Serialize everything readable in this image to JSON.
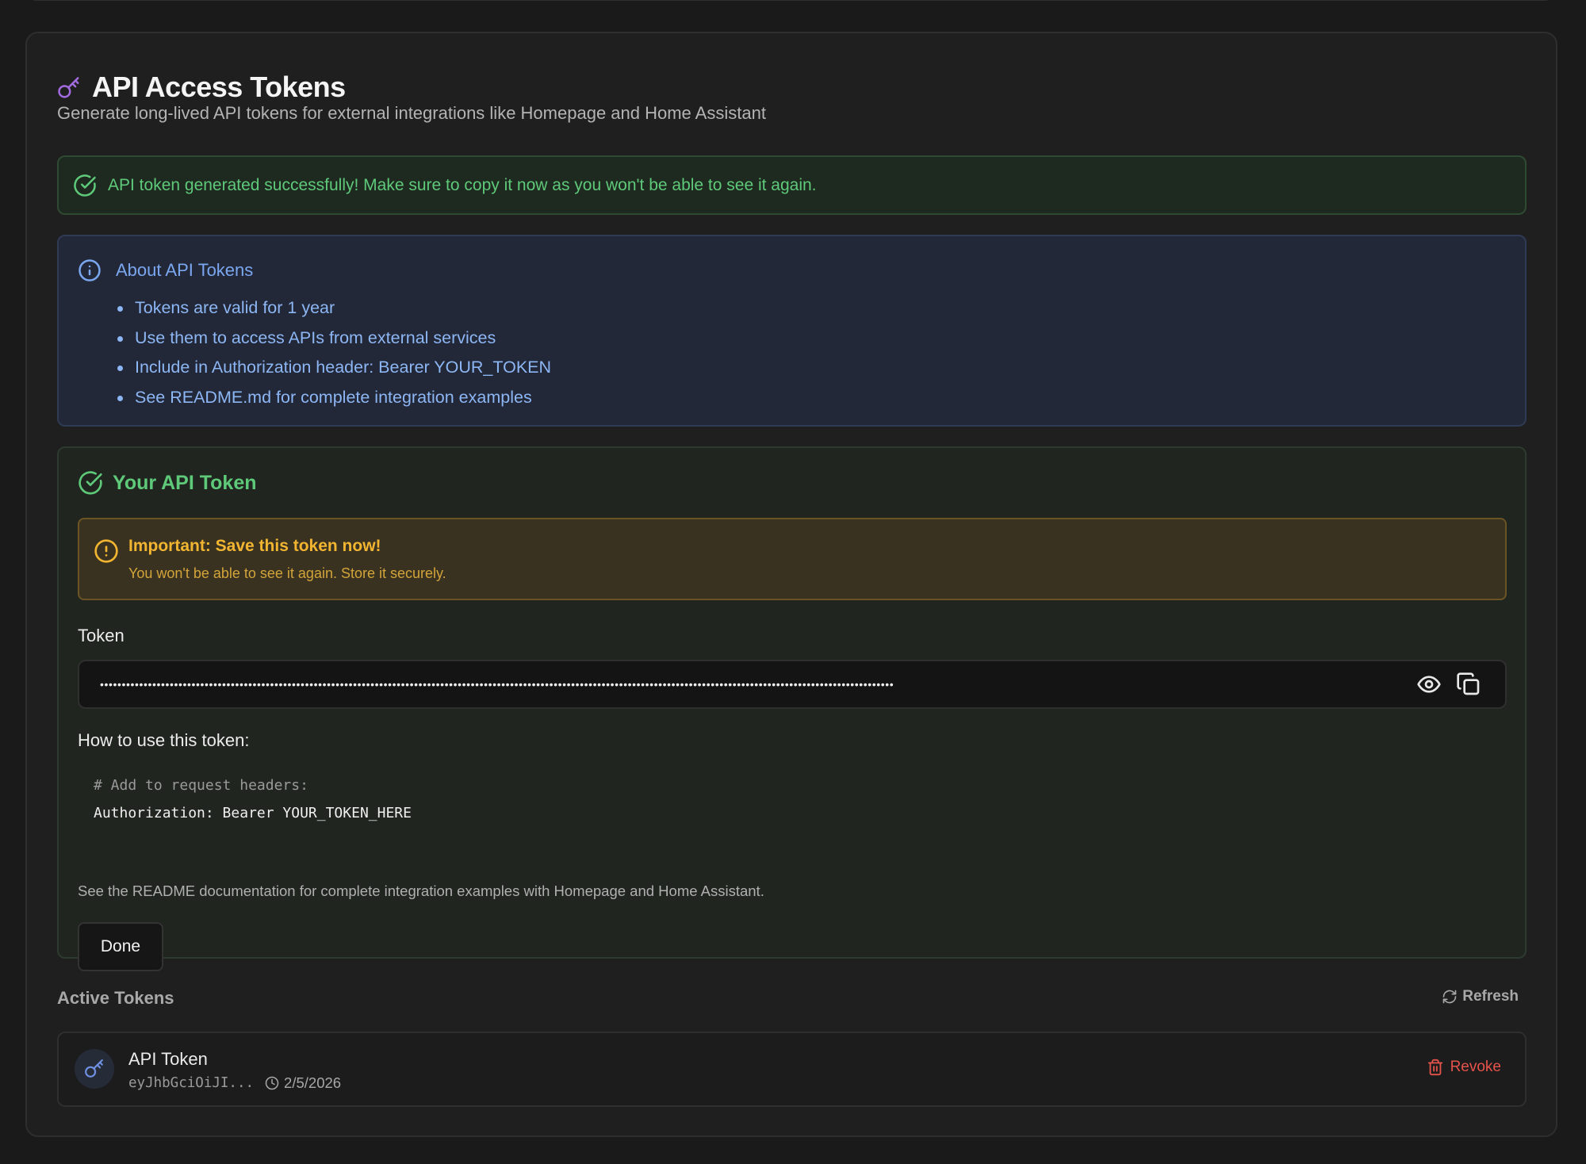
{
  "header": {
    "title": "API Access Tokens",
    "subtitle": "Generate long-lived API tokens for external integrations like Homepage and Home Assistant"
  },
  "success_alert": "API token generated successfully! Make sure to copy it now as you won't be able to see it again.",
  "info": {
    "title": "About API Tokens",
    "items": [
      "Tokens are valid for 1 year",
      "Use them to access APIs from external services",
      "Include in Authorization header: Bearer YOUR_TOKEN",
      "See README.md for complete integration examples"
    ]
  },
  "token_card": {
    "title": "Your API Token",
    "warning_title": "Important: Save this token now!",
    "warning_text": "You won't be able to see it again. Store it securely.",
    "token_label": "Token",
    "token_masked": "••••••••••••••••••••••••••••••••••••••••••••••••••••••••••••••••••••••••••••••••••••••••••••••••••••••••••••••••••••••••••••••••••••••••••••••••••••••••••••••••••••••••••••••••••••••",
    "how_to_title": "How to use this token:",
    "code_comment": "# Add to request headers:",
    "code_line": "Authorization: Bearer YOUR_TOKEN_HERE",
    "readme_note": "See the README documentation for complete integration examples with Homepage and Home Assistant.",
    "done_label": "Done"
  },
  "active_tokens": {
    "title": "Active Tokens",
    "refresh_label": "Refresh",
    "items": [
      {
        "name": "API Token",
        "prefix": "eyJhbGciOiJI...",
        "date": "2/5/2026",
        "revoke_label": "Revoke"
      }
    ]
  },
  "colors": {
    "accent_purple": "#a36be0",
    "success_green": "#5fc97a",
    "info_blue": "#7aa7f0",
    "warning_amber": "#f2b531",
    "danger_red": "#e5534b"
  }
}
